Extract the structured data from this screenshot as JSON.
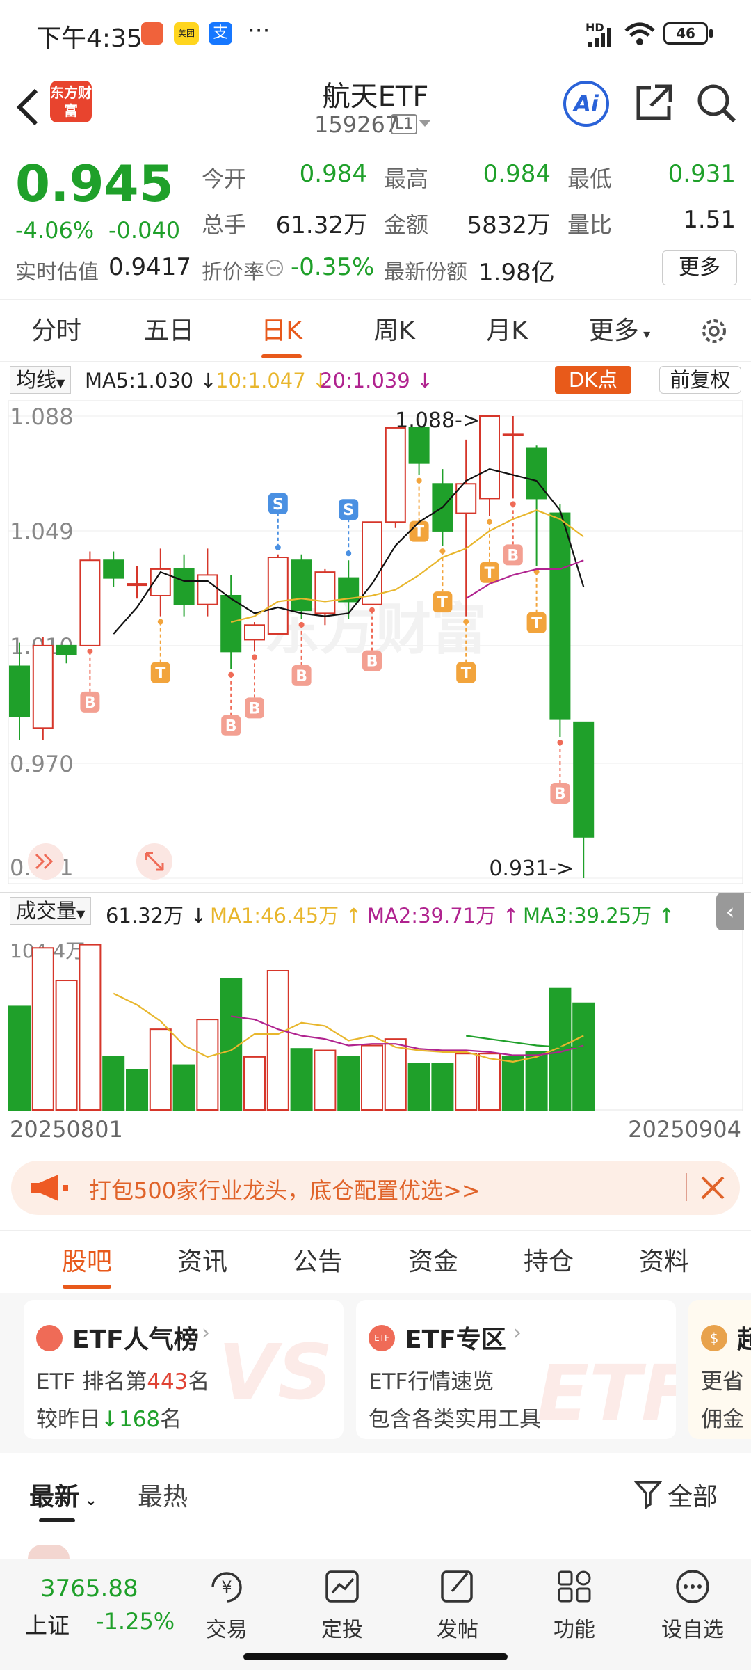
{
  "status_bar": {
    "time": "下午4:35",
    "dots": "···",
    "hd_label": "HD",
    "battery": "46"
  },
  "header": {
    "logo_text": "东方财富",
    "title": "航天ETF",
    "code": "159267",
    "level": "L1",
    "ai_label": "Ai"
  },
  "quote": {
    "price": "0.945",
    "change_pct": "-4.06%",
    "change": "-0.040",
    "est_label": "实时估值",
    "est_value": "0.9417",
    "rows": [
      [
        {
          "label": "今开",
          "value": "0.984",
          "color": "green"
        },
        {
          "label": "最高",
          "value": "0.984",
          "color": "green"
        },
        {
          "label": "最低",
          "value": "0.931",
          "color": "green"
        }
      ],
      [
        {
          "label": "总手",
          "value": "61.32万",
          "color": "dark"
        },
        {
          "label": "金额",
          "value": "5832万",
          "color": "dark"
        },
        {
          "label": "量比",
          "value": "1.51",
          "color": "dark"
        }
      ]
    ],
    "discount_label": "折价率",
    "discount_value": "-0.35%",
    "shares_label": "最新份额",
    "shares_value": "1.98亿",
    "more_btn": "更多"
  },
  "tabs": [
    "分时",
    "五日",
    "日K",
    "周K",
    "月K",
    "更多"
  ],
  "active_tab": "日K",
  "ma_bar": {
    "select": "均线",
    "ma5": "MA5:1.030",
    "ma10": "10:1.047",
    "ma20": "20:1.039",
    "dk": "DK点",
    "fq": "前复权"
  },
  "vol_bar": {
    "select": "成交量",
    "vol": "61.32万",
    "ma1": "MA1:46.45万",
    "ma2": "MA2:39.71万",
    "ma3": "MA3:39.25万"
  },
  "chart_labels": {
    "hi_marker": "1.088->",
    "lo_marker": "0.931->",
    "vol_max": "104.4万",
    "date_start": "20250801",
    "date_end": "20250904",
    "watermark": "东方财富"
  },
  "chart_data": {
    "type": "candlestick",
    "y_ticks": [
      1.088,
      1.049,
      1.01,
      0.97,
      0.931
    ],
    "ylim": [
      0.931,
      1.088
    ],
    "candles": [
      {
        "o": 1.003,
        "c": 0.986,
        "h": 1.011,
        "l": 0.978
      },
      {
        "o": 0.982,
        "c": 1.01,
        "h": 1.013,
        "l": 0.978
      },
      {
        "o": 1.01,
        "c": 1.007,
        "h": 1.01,
        "l": 1.004
      },
      {
        "o": 1.01,
        "c": 1.039,
        "h": 1.042,
        "l": 1.01
      },
      {
        "o": 1.039,
        "c": 1.033,
        "h": 1.042,
        "l": 1.03
      },
      {
        "o": 1.031,
        "c": 1.031,
        "h": 1.037,
        "l": 1.026
      },
      {
        "o": 1.027,
        "c": 1.036,
        "h": 1.043,
        "l": 1.02
      },
      {
        "o": 1.036,
        "c": 1.024,
        "h": 1.041,
        "l": 1.02
      },
      {
        "o": 1.024,
        "c": 1.034,
        "h": 1.043,
        "l": 1.02
      },
      {
        "o": 1.027,
        "c": 1.008,
        "h": 1.034,
        "l": 1.002
      },
      {
        "o": 1.012,
        "c": 1.017,
        "h": 1.018,
        "l": 1.008
      },
      {
        "o": 1.014,
        "c": 1.04,
        "h": 1.041,
        "l": 1.014
      },
      {
        "o": 1.039,
        "c": 1.022,
        "h": 1.041,
        "l": 1.019
      },
      {
        "o": 1.021,
        "c": 1.035,
        "h": 1.036,
        "l": 1.017
      },
      {
        "o": 1.033,
        "c": 1.025,
        "h": 1.039,
        "l": 1.019
      },
      {
        "o": 1.024,
        "c": 1.052,
        "h": 1.052,
        "l": 1.024
      },
      {
        "o": 1.052,
        "c": 1.084,
        "h": 1.084,
        "l": 1.05
      },
      {
        "o": 1.084,
        "c": 1.072,
        "h": 1.084,
        "l": 1.068
      },
      {
        "o": 1.065,
        "c": 1.049,
        "h": 1.07,
        "l": 1.044
      },
      {
        "o": 1.055,
        "c": 1.065,
        "h": 1.08,
        "l": 1.02
      },
      {
        "o": 1.06,
        "c": 1.088,
        "h": 1.088,
        "l": 1.054
      },
      {
        "o": 1.082,
        "c": 1.082,
        "h": 1.088,
        "l": 1.06
      },
      {
        "o": 1.077,
        "c": 1.06,
        "h": 1.078,
        "l": 1.037
      },
      {
        "o": 1.055,
        "c": 0.985,
        "h": 1.058,
        "l": 0.979
      },
      {
        "o": 0.984,
        "c": 0.945,
        "h": 0.984,
        "l": 0.931
      }
    ],
    "volume_max": "104.4万",
    "volumes": [
      64,
      100,
      80,
      102,
      33,
      25,
      50,
      28,
      56,
      81,
      33,
      86,
      38,
      37,
      33,
      40,
      44,
      29,
      29,
      35,
      35,
      33,
      36,
      75,
      66
    ],
    "volume_up": [
      false,
      true,
      true,
      true,
      false,
      false,
      true,
      false,
      true,
      false,
      true,
      true,
      false,
      true,
      false,
      true,
      true,
      false,
      false,
      true,
      true,
      false,
      false,
      false,
      false
    ],
    "ma_lines": {
      "ma5": {
        "color": "#111111",
        "values": [
          null,
          null,
          null,
          null,
          1.014,
          1.023,
          1.035,
          1.032,
          1.032,
          1.026,
          1.021,
          1.023,
          1.021,
          1.02,
          1.021,
          1.031,
          1.044,
          1.052,
          1.057,
          1.066,
          1.07,
          1.068,
          1.066,
          1.056,
          1.03
        ]
      },
      "ma10": {
        "color": "#e8b62c",
        "values": [
          null,
          null,
          null,
          null,
          null,
          null,
          null,
          null,
          null,
          1.018,
          1.02,
          1.025,
          1.026,
          1.025,
          1.026,
          1.027,
          1.029,
          1.034,
          1.04,
          1.043,
          1.049,
          1.053,
          1.056,
          1.053,
          1.047
        ]
      },
      "ma20": {
        "color": "#b0238f",
        "values": [
          null,
          null,
          null,
          null,
          null,
          null,
          null,
          null,
          null,
          null,
          null,
          null,
          null,
          null,
          null,
          null,
          null,
          null,
          null,
          1.026,
          1.031,
          1.034,
          1.036,
          1.036,
          1.039
        ]
      }
    },
    "signals": [
      {
        "i": 3,
        "type": "B"
      },
      {
        "i": 6,
        "type": "T"
      },
      {
        "i": 9,
        "type": "B"
      },
      {
        "i": 10,
        "type": "B"
      },
      {
        "i": 11,
        "type": "S"
      },
      {
        "i": 12,
        "type": "B"
      },
      {
        "i": 14,
        "type": "S"
      },
      {
        "i": 15,
        "type": "B"
      },
      {
        "i": 17,
        "type": "T"
      },
      {
        "i": 18,
        "type": "T"
      },
      {
        "i": 19,
        "type": "T"
      },
      {
        "i": 20,
        "type": "T"
      },
      {
        "i": 21,
        "type": "B"
      },
      {
        "i": 22,
        "type": "T"
      },
      {
        "i": 23,
        "type": "B"
      }
    ],
    "vol_ma": {
      "ma1": {
        "color": "#e8b62c",
        "values": [
          null,
          null,
          null,
          null,
          72,
          65,
          55,
          40,
          33,
          37,
          47,
          47,
          54,
          52,
          43,
          46,
          39,
          37,
          36,
          36,
          32,
          30,
          33,
          39,
          46
        ]
      },
      "ma2": {
        "color": "#b0238f",
        "values": [
          null,
          null,
          null,
          null,
          null,
          null,
          null,
          null,
          null,
          58,
          56,
          50,
          46,
          44,
          40,
          41,
          41,
          38,
          37,
          37,
          36,
          34,
          34,
          36,
          40
        ]
      },
      "ma3": {
        "color": "#1fa02a",
        "values": [
          null,
          null,
          null,
          null,
          null,
          null,
          null,
          null,
          null,
          null,
          null,
          null,
          null,
          null,
          null,
          null,
          null,
          null,
          null,
          46,
          44,
          42,
          40,
          39,
          39
        ]
      }
    }
  },
  "banner": {
    "text": "打包500家行业龙头，底仓配置优选>>"
  },
  "section_tabs": [
    "股吧",
    "资讯",
    "公告",
    "资金",
    "持仓",
    "资料"
  ],
  "active_section": "股吧",
  "cards": [
    {
      "title": "ETF人气榜",
      "line1_pre": "ETF 排名第",
      "line1_num": "443",
      "line1_post": "名",
      "line2_pre": "较昨日",
      "line2_num": "168",
      "line2_post": "名",
      "icon": "E"
    },
    {
      "title": "ETF专区",
      "line1": "ETF行情速览",
      "line2": "包含各类实用工具",
      "icon": "ETF"
    },
    {
      "title": "超",
      "line1": "更省",
      "line2": "佣金",
      "icon": "$"
    }
  ],
  "filter": {
    "latest": "最新",
    "hot": "最热",
    "all": "全部"
  },
  "bottom_bar": {
    "index_value": "3765.88",
    "index_name": "上证",
    "index_pct": "-1.25%",
    "items": [
      "交易",
      "定投",
      "发帖",
      "功能",
      "设自选"
    ]
  }
}
